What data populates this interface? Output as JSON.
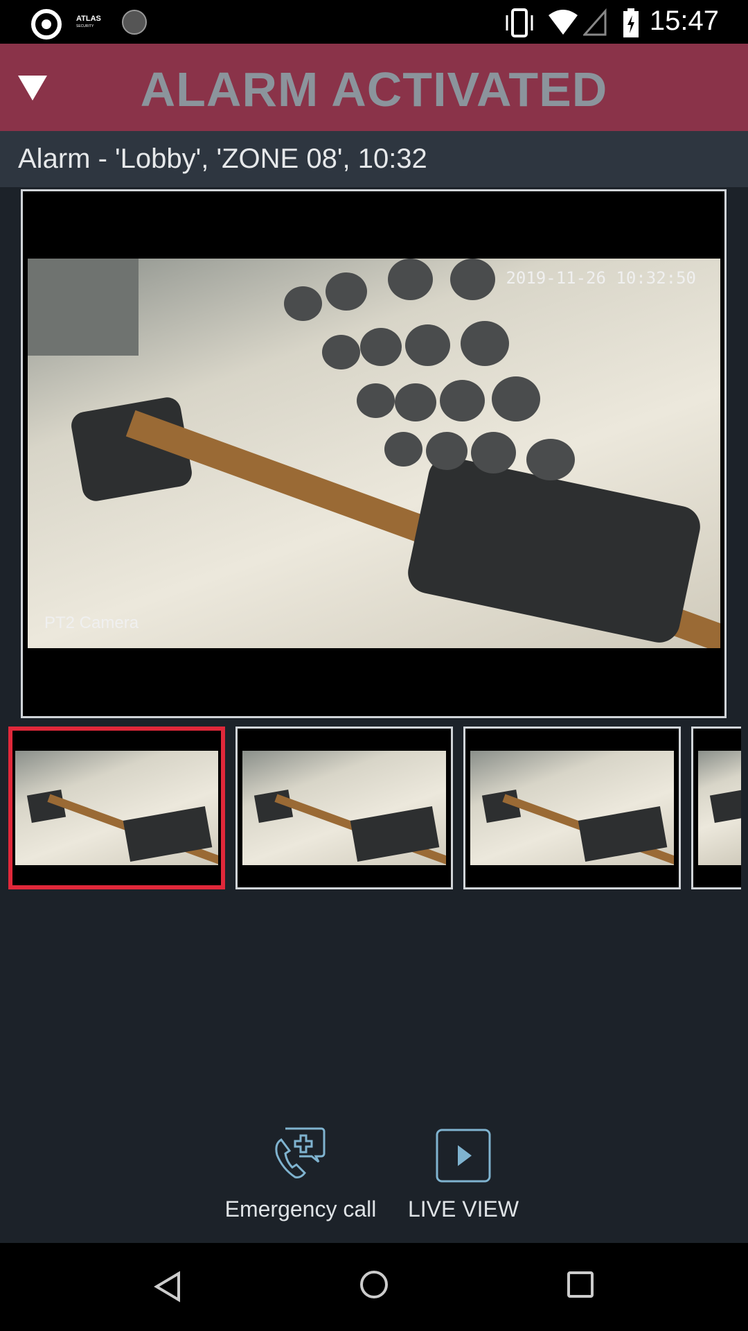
{
  "status_bar": {
    "time": "15:47",
    "icons": [
      "app-logo-icon",
      "atlas-security-icon",
      "loading-icon",
      "vibrate-icon",
      "wifi-icon",
      "signal-icon",
      "battery-charging-icon"
    ]
  },
  "header": {
    "title": "ALARM ACTIVATED",
    "collapse_icon": "triangle-down-icon",
    "background": "#8a3349",
    "title_color": "#8b949c"
  },
  "alarm_info": "Alarm - 'Lobby', 'ZONE 08',  10:32",
  "snapshot": {
    "timestamp": "2019-11-26 10:32:50",
    "camera_label": "PT2 Camera"
  },
  "thumbnails": [
    {
      "selected": true
    },
    {
      "selected": false
    },
    {
      "selected": false
    },
    {
      "selected": false
    }
  ],
  "selection_color": "#e0283a",
  "actions": {
    "emergency_call": "Emergency call",
    "live_view": "LIVE VIEW",
    "icon_color": "#7fb3cf"
  },
  "nav_bar": {
    "icons": [
      "back-icon",
      "home-icon",
      "recents-icon"
    ]
  }
}
